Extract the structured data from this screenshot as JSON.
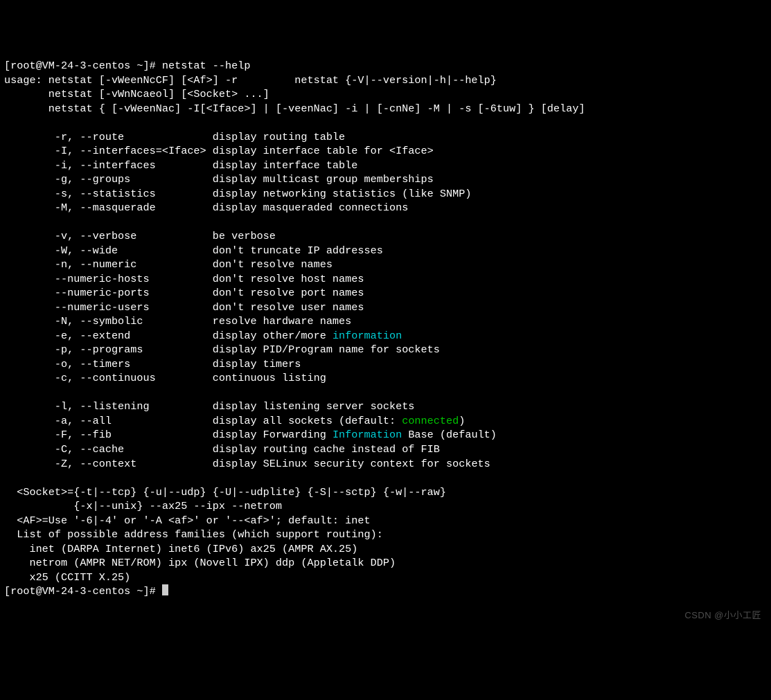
{
  "prompt1": "[root@VM-24-3-centos ~]# ",
  "cmd": "netstat --help",
  "usage1": "usage: netstat [-vWeenNcCF] [<Af>] -r         netstat {-V|--version|-h|--help}",
  "usage2": "       netstat [-vWnNcaeol] [<Socket> ...]",
  "usage3": "       netstat { [-vWeenNac] -I[<Iface>] | [-veenNac] -i | [-cnNe] -M | -s [-6tuw] } [delay]",
  "opts": [
    "-r, --route              display routing table",
    "-I, --interfaces=<Iface> display interface table for <Iface>",
    "-i, --interfaces         display interface table",
    "-g, --groups             display multicast group memberships",
    "-s, --statistics         display networking statistics (like SNMP)",
    "-M, --masquerade         display masqueraded connections"
  ],
  "opts2a": "-v, --verbose            be verbose",
  "opts2b": "-W, --wide               don't truncate IP addresses",
  "opts2c": "-n, --numeric            don't resolve names",
  "opts2d": "--numeric-hosts          don't resolve host names",
  "opts2e": "--numeric-ports          don't resolve port names",
  "opts2f": "--numeric-users          don't resolve user names",
  "opts2g": "-N, --symbolic           resolve hardware names",
  "opts2h_a": "-e, --extend             display other/more ",
  "opts2h_b": "information",
  "opts2i": "-p, --programs           display PID/Program name for sockets",
  "opts2j": "-o, --timers             display timers",
  "opts2k": "-c, --continuous         continuous listing",
  "opts3a": "-l, --listening          display listening server sockets",
  "opts3b_a": "-a, --all                display all sockets (default: ",
  "opts3b_b": "connected",
  "opts3b_c": ")",
  "opts3c_a": "-F, --fib                display Forwarding ",
  "opts3c_b": "Information",
  "opts3c_c": " Base (default)",
  "opts3d": "-C, --cache              display routing cache instead of FIB",
  "opts3e": "-Z, --context            display SELinux security context for sockets",
  "sock1": "  <Socket>={-t|--tcp} {-u|--udp} {-U|--udplite} {-S|--sctp} {-w|--raw}",
  "sock2": "           {-x|--unix} --ax25 --ipx --netrom",
  "af": "  <AF>=Use '-6|-4' or '-A <af>' or '--<af>'; default: inet",
  "list": "  List of possible address families (which support routing):",
  "fam1": "    inet (DARPA Internet) inet6 (IPv6) ax25 (AMPR AX.25) ",
  "fam2": "    netrom (AMPR NET/ROM) ipx (Novell IPX) ddp (Appletalk DDP) ",
  "fam3": "    x25 (CCITT X.25) ",
  "prompt2": "[root@VM-24-3-centos ~]# ",
  "watermark": "CSDN @小小工匠"
}
